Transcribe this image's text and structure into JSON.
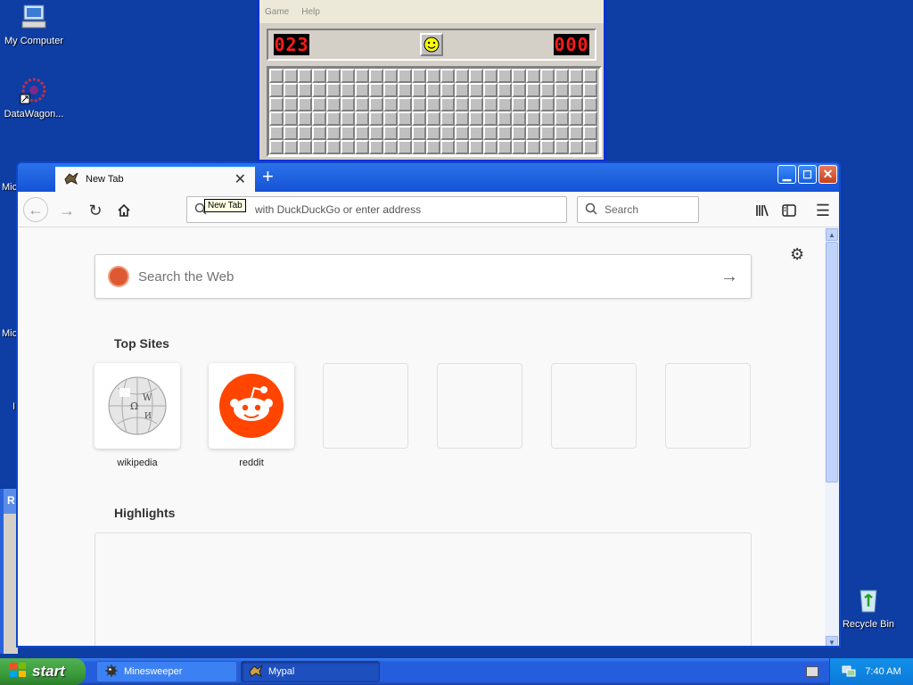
{
  "desktop": {
    "icons": [
      {
        "label": "My Computer"
      },
      {
        "label": "DataWagon..."
      },
      {
        "label": "Recycle Bin"
      }
    ],
    "partial_labels": [
      "Mic",
      "Mic",
      "I"
    ]
  },
  "minesweeper": {
    "menu": [
      "Game",
      "Help"
    ],
    "mine_counter": "023",
    "timer": "000",
    "face": "smiley"
  },
  "browser": {
    "tab_title": "New Tab",
    "tooltip": "New Tab",
    "url_placeholder": "with DuckDuckGo or enter address",
    "search_placeholder": "Search",
    "web_search_placeholder": "Search the Web",
    "top_sites_title": "Top Sites",
    "highlights_title": "Highlights",
    "top_sites": [
      {
        "label": "wikipedia",
        "icon": "wikipedia-globe-icon"
      },
      {
        "label": "reddit",
        "icon": "reddit-alien-icon"
      },
      {
        "label": ""
      },
      {
        "label": ""
      },
      {
        "label": ""
      },
      {
        "label": ""
      }
    ]
  },
  "partial_window": {
    "title": "R"
  },
  "taskbar": {
    "start_label": "start",
    "items": [
      {
        "label": "Minesweeper",
        "active": false
      },
      {
        "label": "Mypal",
        "active": true
      }
    ],
    "clock": "7:40 AM"
  },
  "colors": {
    "desktop_bg": "#0E3DA3",
    "accent_blue": "#0a84ff",
    "reddit_orange": "#ff4500"
  }
}
